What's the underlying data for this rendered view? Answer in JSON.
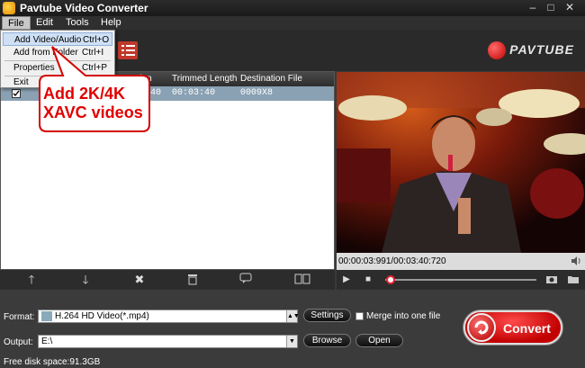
{
  "window": {
    "title": "Pavtube Video Converter"
  },
  "menu": {
    "items": [
      "File",
      "Edit",
      "Tools",
      "Help"
    ]
  },
  "file_menu": {
    "items": [
      {
        "label": "Add Video/Audio",
        "shortcut": "Ctrl+O"
      },
      {
        "label": "Add from Folder",
        "shortcut": "Ctrl+I"
      },
      {
        "label": "Properties",
        "shortcut": "Ctrl+P"
      },
      {
        "label": "Exit",
        "shortcut": ""
      }
    ]
  },
  "brand": {
    "name": "PAVTUBE"
  },
  "file_list": {
    "columns": [
      "ation",
      "Trimmed Length",
      "Destination File"
    ],
    "rows": [
      {
        "duration": "40",
        "trimmed": "00:03:40",
        "dest": "0009X8"
      }
    ]
  },
  "callout": {
    "line1": "Add 2K/4K",
    "line2": "XAVC videos"
  },
  "player": {
    "time": "00:00:03:991/00:03:40:720",
    "progress": 0.02
  },
  "output": {
    "format_label": "Format:",
    "format_value": "H.264 HD Video(*.mp4)",
    "settings_label": "Settings",
    "merge_label": "Merge into one file",
    "output_label": "Output:",
    "output_value": "E:\\",
    "browse_label": "Browse",
    "open_label": "Open",
    "convert_label": "Convert",
    "disk_space": "Free disk space:91.3GB"
  },
  "colors": {
    "accent": "#d40000",
    "callout": "#e00000",
    "row_selected": "#8aa1b3"
  }
}
